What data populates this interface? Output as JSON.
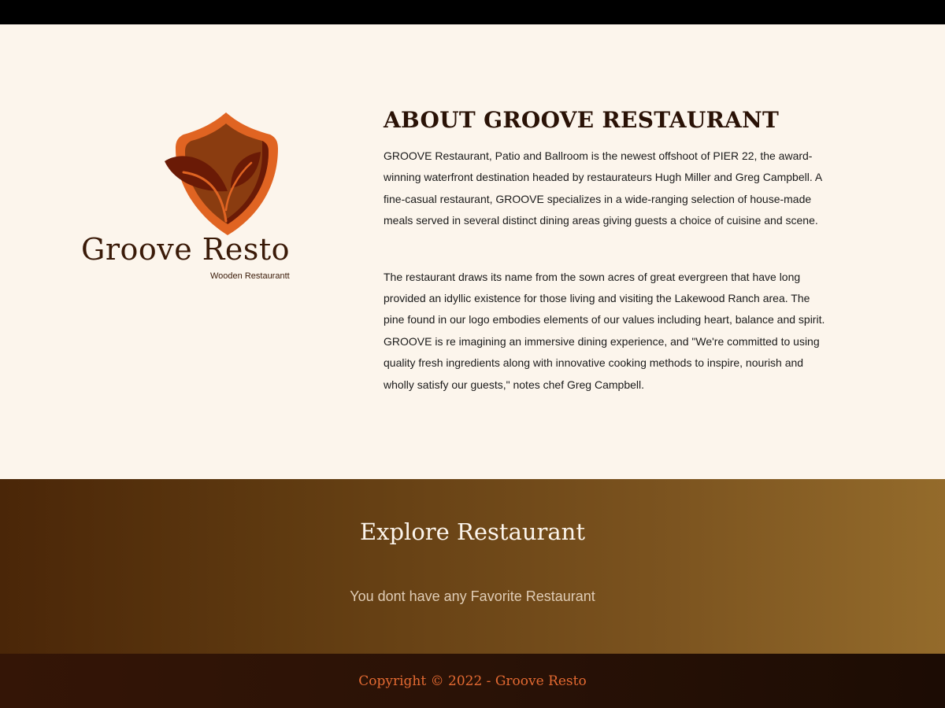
{
  "colors": {
    "background": "#fcf5ec",
    "heading": "#2a1206",
    "shield_outer": "#e06422",
    "shield_inner": "#8a3c10",
    "leaf": "#6a1a06",
    "footer_text": "#e46a32"
  },
  "logo": {
    "icon": "leaf-shield-icon",
    "title": "Groove Resto",
    "tagline": "Wooden Restaurantt"
  },
  "about": {
    "heading": "ABOUT GROOVE RESTAURANT",
    "paragraph_1": "GROOVE Restaurant, Patio and Ballroom is the newest offshoot of PIER 22, the award-winning waterfront destination headed by restaurateurs Hugh Miller and Greg Campbell. A fine-casual restaurant, GROOVE specializes in a wide-ranging selection of house-made meals served in several distinct dining areas giving guests a choice of cuisine and scene.",
    "paragraph_2": "The restaurant draws its name from the sown acres of great evergreen that have long provided an idyllic existence for those living and visiting the Lakewood Ranch area. The pine found in our logo embodies elements of our values including heart, balance and spirit. GROOVE is re imagining an immersive dining experience, and \"We're committed to using quality fresh ingredients along with innovative cooking methods to inspire, nourish and wholly satisfy our guests,\" notes chef Greg Campbell."
  },
  "explore": {
    "title": "Explore Restaurant",
    "empty_message": "You dont have any Favorite Restaurant"
  },
  "footer": {
    "copyright": "Copyright © 2022 - Groove Resto"
  }
}
